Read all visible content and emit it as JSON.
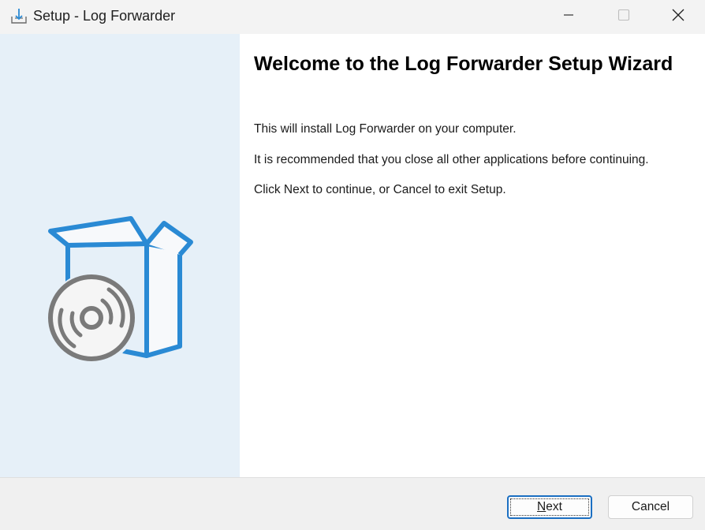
{
  "window": {
    "title": "Setup - Log Forwarder",
    "icon": "installer-download-icon",
    "controls": {
      "minimize": "minimize-icon",
      "maximize": "maximize-icon",
      "close": "close-icon"
    }
  },
  "banner": {
    "illustration": "software-box-disc-icon",
    "background_color": "#e6f0f8",
    "accent_color": "#2a8ad4",
    "disc_color": "#7a7a7a"
  },
  "content": {
    "heading": "Welcome to the Log Forwarder Setup Wizard",
    "paragraphs": [
      "This will install Log Forwarder on your computer.",
      "It is recommended that you close all other applications before continuing.",
      "Click Next to continue, or Cancel to exit Setup."
    ]
  },
  "footer": {
    "next_accel": "N",
    "next_rest": "ext",
    "cancel_label": "Cancel"
  }
}
